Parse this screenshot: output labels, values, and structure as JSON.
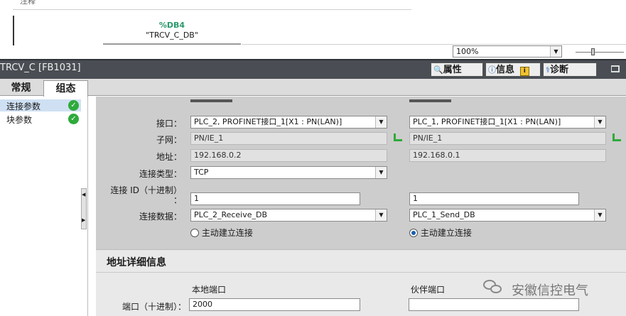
{
  "top": {
    "comment_label": "注释",
    "db_symbol": "%DB4",
    "db_name": "\"TRCV_C_DB\"",
    "zoom_value": "100%"
  },
  "header": {
    "title": "TRCV_C [FB1031]",
    "tab_properties": "属性",
    "tab_info": "信息",
    "tab_diagnostics": "诊断"
  },
  "tabs": {
    "general": "常规",
    "configuration": "组态"
  },
  "sidebar": {
    "items": [
      {
        "label": "连接参数"
      },
      {
        "label": "块参数"
      }
    ]
  },
  "form": {
    "interface_label": "接口：",
    "subnet_label": "子网：",
    "address_label": "地址：",
    "conn_type_label": "连接类型：",
    "conn_id_label_1": "连接 ID（十进制）",
    "conn_id_label_2": "：",
    "conn_data_label": "连接数据：",
    "local": {
      "interface": "PLC_2, PROFINET接口_1[X1 : PN(LAN)]",
      "subnet": "PN/IE_1",
      "address": "192.168.0.2",
      "conn_type": "TCP",
      "conn_id": "1",
      "conn_data": "PLC_2_Receive_DB",
      "active_label": "主动建立连接"
    },
    "partner": {
      "interface": "PLC_1, PROFINET接口_1[X1 : PN(LAN)]",
      "subnet": "PN/IE_1",
      "address": "192.168.0.1",
      "conn_id": "1",
      "conn_data": "PLC_1_Send_DB",
      "active_label": "主动建立连接"
    }
  },
  "details": {
    "title": "地址详细信息",
    "local_port_header": "本地端口",
    "partner_port_header": "伙伴端口",
    "port_label": "端口（十进制）：",
    "local_port": "2000",
    "partner_port": ""
  },
  "watermark": {
    "text": "安徽信控电气"
  }
}
